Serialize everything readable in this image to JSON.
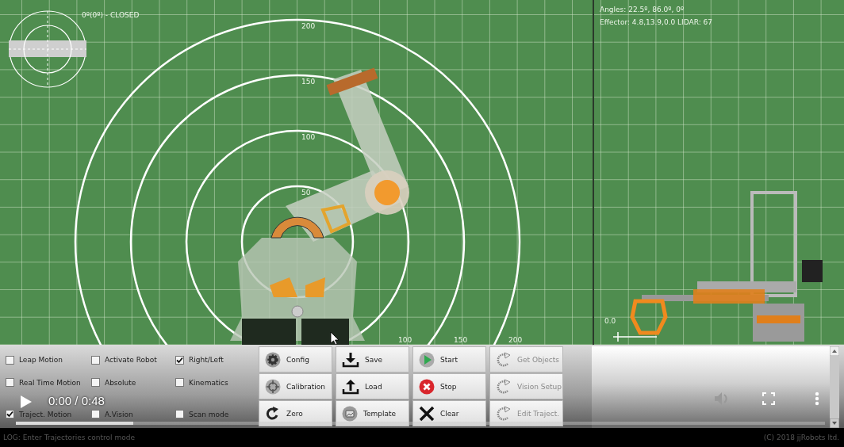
{
  "top_view": {
    "gripper_status": "0º(0º) - CLOSED",
    "ring_labels": [
      "200",
      "150",
      "100",
      "50"
    ],
    "axis_labels": [
      "100",
      "150",
      "200"
    ]
  },
  "side_view": {
    "angles": "Angles: 22.5º, 86.0º, 0º",
    "effector": "Effector: 4.8,13.9,0.0 LIDAR: 67",
    "origin_label": "0.0"
  },
  "options": [
    {
      "label": "Leap Motion",
      "checked": false
    },
    {
      "label": "Real Time Motion",
      "checked": false
    },
    {
      "label": "Traject. Motion",
      "checked": true
    },
    {
      "label": "Activate Robot",
      "checked": false
    },
    {
      "label": "Absolute",
      "checked": false
    },
    {
      "label": "A.Vision",
      "checked": false
    },
    {
      "label": "Right/Left",
      "checked": true
    },
    {
      "label": "Kinematics",
      "checked": false
    },
    {
      "label": "Scan mode",
      "checked": false
    }
  ],
  "buttons": [
    {
      "label": "Config",
      "kind": "gear",
      "disabled": false
    },
    {
      "label": "Calibration",
      "kind": "target",
      "disabled": false
    },
    {
      "label": "Zero",
      "kind": "rotate",
      "disabled": false
    },
    {
      "label": "Save",
      "kind": "download",
      "disabled": false
    },
    {
      "label": "Load",
      "kind": "upload",
      "disabled": false
    },
    {
      "label": "Template",
      "kind": "image",
      "disabled": false
    },
    {
      "label": "Start",
      "kind": "play",
      "disabled": false
    },
    {
      "label": "Stop",
      "kind": "stop",
      "disabled": false
    },
    {
      "label": "Clear",
      "kind": "clear",
      "disabled": false
    },
    {
      "label": "Get Objects",
      "kind": "refresh",
      "disabled": true
    },
    {
      "label": "Vision Setup",
      "kind": "refresh",
      "disabled": true
    },
    {
      "label": "Edit Traject.",
      "kind": "refresh",
      "disabled": true
    }
  ],
  "status_bar": {
    "log": "LOG: Enter Trajectories control mode",
    "copyright": "(C) 2018 jjRobots ltd."
  },
  "video_player": {
    "time": "0:00 / 0:48",
    "progress": {
      "level": 0.145
    }
  }
}
